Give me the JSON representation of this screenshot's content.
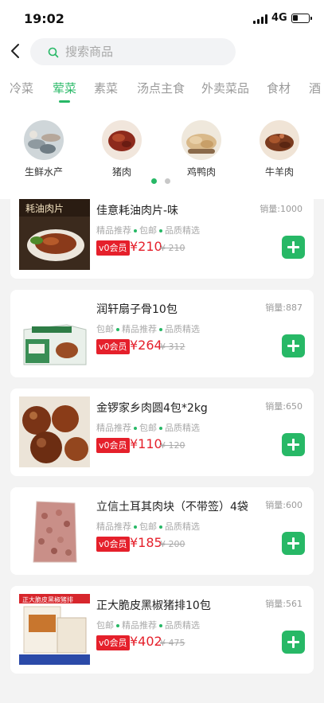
{
  "status_bar": {
    "time": "19:02",
    "network": "4G",
    "battery_level": 0.35
  },
  "search": {
    "placeholder": "搜索商品"
  },
  "tabs": [
    {
      "label": "冷菜",
      "active": false
    },
    {
      "label": "荤菜",
      "active": true
    },
    {
      "label": "素菜",
      "active": false
    },
    {
      "label": "汤点主食",
      "active": false
    },
    {
      "label": "外卖菜品",
      "active": false
    },
    {
      "label": "食材",
      "active": false
    },
    {
      "label": "酒",
      "active": false
    }
  ],
  "categories": [
    {
      "label": "生鲜水产",
      "icon": "seafood-icon"
    },
    {
      "label": "猪肉",
      "icon": "pork-icon"
    },
    {
      "label": "鸡鸭肉",
      "icon": "poultry-icon"
    },
    {
      "label": "牛羊肉",
      "icon": "beef-icon"
    }
  ],
  "pager": {
    "pages": 2,
    "current": 1
  },
  "products": [
    {
      "name": "佳意耗油肉片-味",
      "sales": "销量:1000",
      "tags": [
        "精品推荐",
        "包邮",
        "品质精选"
      ],
      "vip_label": "v0会员",
      "price": "¥210",
      "orig_price": "¥ 210",
      "thumb_text": "耗油肉片"
    },
    {
      "name": "润轩扇子骨10包",
      "sales": "销量:887",
      "tags": [
        "包邮",
        "精品推荐",
        "品质精选"
      ],
      "vip_label": "v0会员",
      "price": "¥264",
      "orig_price": "¥ 312",
      "thumb_text": ""
    },
    {
      "name": "金锣家乡肉圆4包*2kg",
      "sales": "销量:650",
      "tags": [
        "精品推荐",
        "包邮",
        "品质精选"
      ],
      "vip_label": "v0会员",
      "price": "¥110",
      "orig_price": "¥ 120",
      "thumb_text": ""
    },
    {
      "name": "立信土耳其肉块（不带签）4袋",
      "sales": "销量:600",
      "tags": [
        "精品推荐",
        "包邮",
        "品质精选"
      ],
      "vip_label": "v0会员",
      "price": "¥185",
      "orig_price": "¥ 200",
      "thumb_text": ""
    },
    {
      "name": "正大脆皮黑椒猪排10包",
      "sales": "销量:561",
      "tags": [
        "包邮",
        "精品推荐",
        "品质精选"
      ],
      "vip_label": "v0会员",
      "price": "¥402",
      "orig_price": "¥ 475",
      "thumb_text": "正大脆皮黑椒猪排"
    }
  ],
  "colors": {
    "accent": "#27b866",
    "price": "#e5202b"
  }
}
